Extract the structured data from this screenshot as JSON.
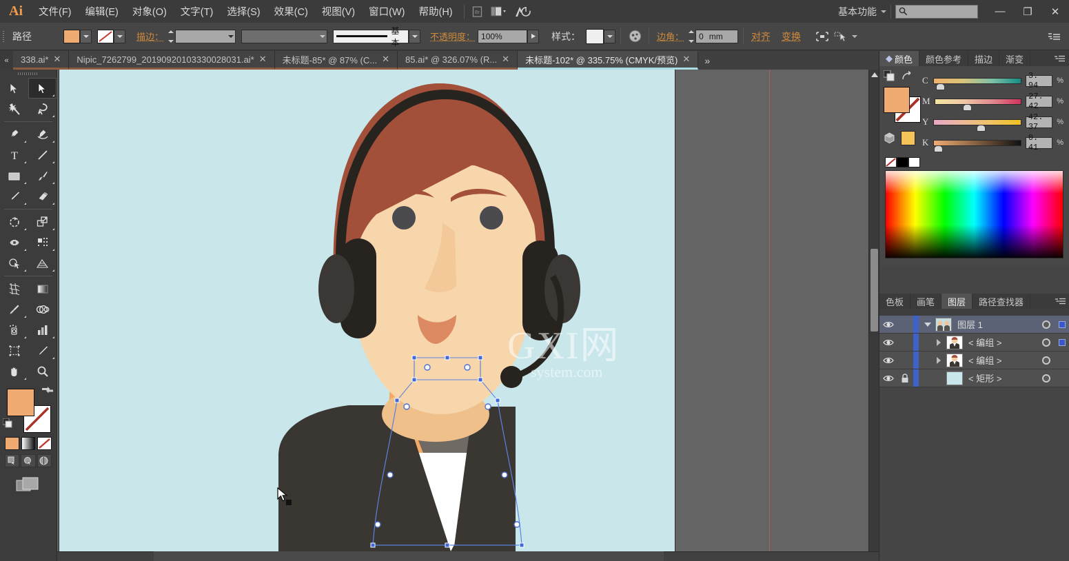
{
  "app": {
    "logo": "Ai",
    "workspace": "基本功能"
  },
  "menu": {
    "items": [
      {
        "label": "文件(F)",
        "name": "menu-file"
      },
      {
        "label": "编辑(E)",
        "name": "menu-edit"
      },
      {
        "label": "对象(O)",
        "name": "menu-object"
      },
      {
        "label": "文字(T)",
        "name": "menu-type"
      },
      {
        "label": "选择(S)",
        "name": "menu-select"
      },
      {
        "label": "效果(C)",
        "name": "menu-effect"
      },
      {
        "label": "视图(V)",
        "name": "menu-view"
      },
      {
        "label": "窗口(W)",
        "name": "menu-window"
      },
      {
        "label": "帮助(H)",
        "name": "menu-help"
      }
    ],
    "bridge_icon": "bridge-icon",
    "arrange_icon": "arrange-documents-icon",
    "stock_icon": "adobe-stock-icon"
  },
  "search": {
    "placeholder": "",
    "value": "",
    "icon": "search-icon"
  },
  "window_controls": {
    "minimize": "—",
    "restore": "❐",
    "close": "✕"
  },
  "control_bar": {
    "object_label": "路径",
    "fill_swatch_color": "#f0ab72",
    "stroke_swatch": "none",
    "stroke_label": "描边：",
    "stroke_weight": "",
    "stroke_profile": "",
    "brush_definition": "基本",
    "opacity_label": "不透明度：",
    "opacity_value": "100%",
    "style_label": "样式：",
    "corner_label": "边角：",
    "corner_value": "0",
    "corner_unit": "mm",
    "align_label": "对齐",
    "transform_label": "变换",
    "isolate_icon": "isolate-selected-icon",
    "select_similar_icon": "select-similar-objects-icon",
    "panel_menu_icon": "panel-menu-icon",
    "recolor_icon": "recolor-artwork-icon"
  },
  "tabs": {
    "scroll_left_icon": "scroll-left-icon",
    "more_icon": "more-tabs-icon",
    "items": [
      {
        "label": "338.ai*",
        "active": false,
        "close": "✕"
      },
      {
        "label": "Nipic_7262799_20190920103330028031.ai*",
        "active": false,
        "close": "✕"
      },
      {
        "label": "未标题-85* @ 87% (C...",
        "active": false,
        "close": "✕"
      },
      {
        "label": "85.ai* @ 326.07% (R...",
        "active": false,
        "close": "✕"
      },
      {
        "label": "未标题-102* @ 335.75% (CMYK/预览)",
        "active": true,
        "close": "✕"
      }
    ]
  },
  "toolbar": {
    "tools": [
      {
        "name": "selection-tool",
        "icon": "arrow-black",
        "selected": false
      },
      {
        "name": "direct-selection-tool",
        "icon": "arrow-white",
        "selected": true
      },
      {
        "name": "magic-wand-tool",
        "icon": "magic-wand",
        "selected": false
      },
      {
        "name": "lasso-tool",
        "icon": "lasso",
        "selected": false
      },
      {
        "name": "pen-tool",
        "icon": "pen",
        "selected": false
      },
      {
        "name": "curvature-tool",
        "icon": "curvature",
        "selected": false
      },
      {
        "name": "type-tool",
        "icon": "type-T",
        "selected": false
      },
      {
        "name": "line-segment-tool",
        "icon": "line",
        "selected": false
      },
      {
        "name": "rectangle-tool",
        "icon": "rectangle",
        "selected": false
      },
      {
        "name": "paintbrush-tool",
        "icon": "paintbrush",
        "selected": false
      },
      {
        "name": "pencil-tool",
        "icon": "pencil",
        "selected": false
      },
      {
        "name": "eraser-tool",
        "icon": "eraser",
        "selected": false
      },
      {
        "name": "rotate-tool",
        "icon": "rotate",
        "selected": false
      },
      {
        "name": "scale-tool",
        "icon": "scale",
        "selected": false
      },
      {
        "name": "width-tool",
        "icon": "width",
        "selected": false
      },
      {
        "name": "free-transform-tool",
        "icon": "free-transform",
        "selected": false
      },
      {
        "name": "shape-builder-tool",
        "icon": "shape-builder",
        "selected": false
      },
      {
        "name": "perspective-grid-tool",
        "icon": "perspective-grid",
        "selected": false
      },
      {
        "name": "mesh-tool",
        "icon": "mesh",
        "selected": false
      },
      {
        "name": "gradient-tool",
        "icon": "gradient",
        "selected": false
      },
      {
        "name": "eyedropper-tool",
        "icon": "eyedropper",
        "selected": false
      },
      {
        "name": "blend-tool",
        "icon": "blend",
        "selected": false
      },
      {
        "name": "symbol-sprayer-tool",
        "icon": "symbol-sprayer",
        "selected": false
      },
      {
        "name": "column-graph-tool",
        "icon": "column-graph",
        "selected": false
      },
      {
        "name": "artboard-tool",
        "icon": "artboard",
        "selected": false
      },
      {
        "name": "slice-tool",
        "icon": "slice",
        "selected": false
      },
      {
        "name": "hand-tool",
        "icon": "hand",
        "selected": false
      },
      {
        "name": "zoom-tool",
        "icon": "magnifier",
        "selected": false
      }
    ],
    "fill_color": "#f0ab72",
    "stroke_color": "none",
    "swap_icon": "swap-fill-stroke-icon",
    "default_icon": "default-fill-stroke-icon",
    "paint_modes": [
      {
        "name": "color-mode",
        "icon": "solid-color"
      },
      {
        "name": "gradient-mode",
        "icon": "gradient"
      },
      {
        "name": "none-mode",
        "icon": "none"
      }
    ],
    "draw_modes": [
      {
        "name": "draw-normal-mode",
        "icon": "draw-normal"
      },
      {
        "name": "draw-behind-mode",
        "icon": "draw-behind"
      },
      {
        "name": "draw-inside-mode",
        "icon": "draw-inside"
      }
    ],
    "screen_mode": {
      "name": "change-screen-mode",
      "icon": "screen-mode"
    }
  },
  "canvas": {
    "artboard_bg": "#c9e7ea",
    "watermark_line1": "GXI网",
    "watermark_line2": "system.com",
    "cursor_icon": "direct-selection-cursor",
    "guide_color": "#b4605a"
  },
  "panels": {
    "top_tabs": [
      {
        "label": "颜色",
        "active": true,
        "name": "panel-tab-color"
      },
      {
        "label": "颜色参考",
        "active": false,
        "name": "panel-tab-color-guide"
      },
      {
        "label": "描边",
        "active": false,
        "name": "panel-tab-stroke"
      },
      {
        "label": "渐变",
        "active": false,
        "name": "panel-tab-gradient"
      }
    ],
    "bottom_tabs": [
      {
        "label": "色板",
        "active": false,
        "name": "panel-tab-swatches"
      },
      {
        "label": "画笔",
        "active": false,
        "name": "panel-tab-brushes"
      },
      {
        "label": "图层",
        "active": true,
        "name": "panel-tab-layers"
      },
      {
        "label": "路径查找器",
        "active": false,
        "name": "panel-tab-pathfinder"
      }
    ]
  },
  "color_panel": {
    "mode": "CMYK",
    "fill_color": "#f0ab72",
    "channels": [
      {
        "label": "C",
        "value": "3. 94",
        "unit": "%",
        "pos": 4
      },
      {
        "label": "M",
        "value": "27. 42",
        "unit": "%",
        "pos": 27
      },
      {
        "label": "Y",
        "value": "42. 37",
        "unit": "%",
        "pos": 42
      },
      {
        "label": "K",
        "value": "0. 41",
        "unit": "%",
        "pos": 0
      }
    ],
    "none_swatch": "none",
    "black_swatch": "#000000",
    "white_swatch": "#ffffff"
  },
  "layers_panel": {
    "rows": [
      {
        "name": "图层 1",
        "visible": true,
        "locked": false,
        "expanded": true,
        "indent": 0,
        "has_children": true,
        "selected": true,
        "thumb": "#c6dde0",
        "row_type": "layer"
      },
      {
        "name": "< 编组 >",
        "visible": true,
        "locked": false,
        "expanded": false,
        "indent": 1,
        "has_children": true,
        "selected": true,
        "thumb": "#f3cfa8",
        "row_type": "group"
      },
      {
        "name": "< 编组 >",
        "visible": true,
        "locked": false,
        "expanded": false,
        "indent": 1,
        "has_children": true,
        "selected": false,
        "thumb": "#f3cfa8",
        "row_type": "group"
      },
      {
        "name": "< 矩形 >",
        "visible": true,
        "locked": true,
        "expanded": false,
        "indent": 1,
        "has_children": false,
        "selected": false,
        "thumb": "#c9e7ea",
        "row_type": "path"
      }
    ],
    "eye_icon": "eye-icon",
    "lock_icon": "lock-icon",
    "expand_icon": "triangle-icon",
    "target_icon": "target-circle-icon"
  }
}
